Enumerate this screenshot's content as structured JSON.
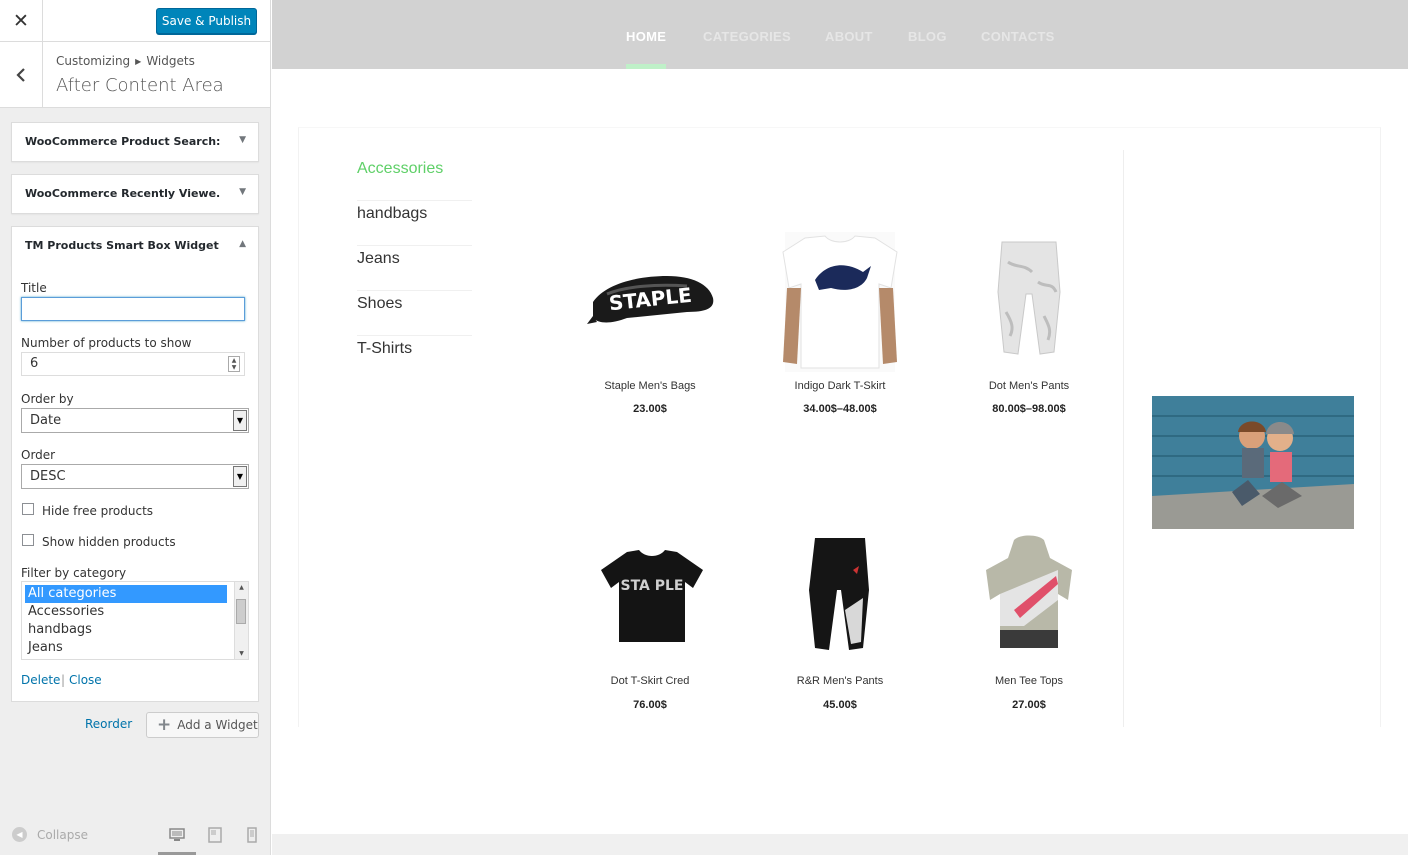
{
  "sidebar": {
    "publish_label": "Save & Publish",
    "breadcrumb": {
      "root": "Customizing",
      "section": "Widgets"
    },
    "section_title": "After Content Area",
    "widgets": [
      {
        "title": "WooCommerce Product Search:..."
      },
      {
        "title": "WooCommerce Recently Viewe..."
      },
      {
        "title": "TM Products Smart Box Widget"
      }
    ],
    "form": {
      "title_label": "Title",
      "title_value": "",
      "number_label": "Number of products to show",
      "number_value": "6",
      "orderby_label": "Order by",
      "orderby_value": "Date",
      "order_label": "Order",
      "order_value": "DESC",
      "hide_free_label": "Hide free products",
      "show_hidden_label": "Show hidden products",
      "filter_label": "Filter by category",
      "categories": [
        "All categories",
        "Accessories",
        "handbags",
        "Jeans"
      ],
      "delete_label": "Delete",
      "close_label": "Close"
    },
    "reorder_label": "Reorder",
    "add_widget_label": "Add a Widget",
    "collapse_label": "Collapse"
  },
  "preview": {
    "nav": [
      "HOME",
      "CATEGORIES",
      "ABOUT",
      "BLOG",
      "CONTACTS"
    ],
    "categories": [
      "Accessories",
      "handbags",
      "Jeans",
      "Shoes",
      "T-Shirts"
    ],
    "products": [
      {
        "name": "Staple Men's Bags",
        "price": "23.00$"
      },
      {
        "name": "Indigo Dark T-Skirt",
        "price": "34.00$–48.00$"
      },
      {
        "name": "Dot Men's Pants",
        "price": "80.00$–98.00$"
      },
      {
        "name": "Dot T-Skirt Cred",
        "price": "76.00$"
      },
      {
        "name": "R&R Men's Pants",
        "price": "45.00$"
      },
      {
        "name": "Men Tee Tops",
        "price": "27.00$"
      }
    ],
    "product_image_text": {
      "bag": "STAPLE",
      "tee": "STA PLE"
    }
  },
  "colors": {
    "accent": "#0085ba",
    "link": "#0073aa",
    "active_category": "#5fd068",
    "nav_bg": "#d2d2d2"
  }
}
